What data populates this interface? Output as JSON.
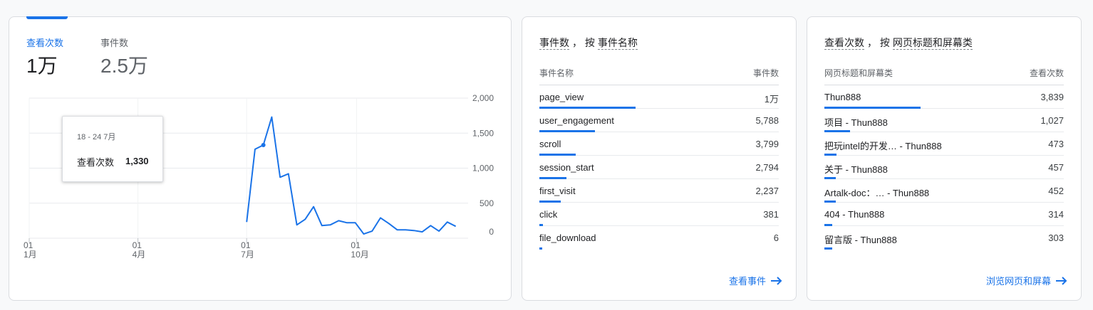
{
  "overview": {
    "tabs": [
      {
        "label": "查看次数",
        "value": "1万",
        "active": true
      },
      {
        "label": "事件数",
        "value": "2.5万",
        "active": false
      }
    ],
    "tooltip": {
      "date": "18 - 24 7月",
      "label": "查看次数",
      "value": "1,330"
    },
    "chart_data": {
      "type": "line",
      "x_tick_labels": [
        {
          "day": "01",
          "month": "1月"
        },
        {
          "day": "01",
          "month": "4月"
        },
        {
          "day": "01",
          "month": "7月"
        },
        {
          "day": "01",
          "month": "10月"
        }
      ],
      "y_tick_labels": [
        "2,000",
        "1,500",
        "1,000",
        "500",
        "0"
      ],
      "ylim": [
        0,
        2000
      ],
      "series": [
        {
          "color": "#1a73e8",
          "points": [
            [
              "2024-07-01",
              230
            ],
            [
              "2024-07-08",
              1270
            ],
            [
              "2024-07-15",
              1330
            ],
            [
              "2024-07-22",
              1730
            ],
            [
              "2024-07-29",
              870
            ],
            [
              "2024-08-05",
              920
            ],
            [
              "2024-08-12",
              190
            ],
            [
              "2024-08-19",
              270
            ],
            [
              "2024-08-26",
              450
            ],
            [
              "2024-09-02",
              180
            ],
            [
              "2024-09-09",
              190
            ],
            [
              "2024-09-16",
              250
            ],
            [
              "2024-09-23",
              220
            ],
            [
              "2024-09-30",
              220
            ],
            [
              "2024-10-07",
              60
            ],
            [
              "2024-10-14",
              100
            ],
            [
              "2024-10-21",
              290
            ],
            [
              "2024-10-28",
              210
            ],
            [
              "2024-11-04",
              120
            ],
            [
              "2024-11-11",
              120
            ],
            [
              "2024-11-18",
              110
            ],
            [
              "2024-11-25",
              90
            ],
            [
              "2024-12-02",
              180
            ],
            [
              "2024-12-09",
              100
            ],
            [
              "2024-12-16",
              230
            ],
            [
              "2024-12-23",
              170
            ]
          ],
          "highlight": "2024-07-15"
        }
      ],
      "grid": true
    }
  },
  "events": {
    "title_metric": "事件数",
    "title_sep": "， 按",
    "title_dim": "事件名称",
    "col_name": "事件名称",
    "col_value": "事件数",
    "rows": [
      {
        "name": "page_view",
        "value": "1万",
        "ratio": 1.0
      },
      {
        "name": "user_engagement",
        "value": "5,788",
        "ratio": 0.575
      },
      {
        "name": "scroll",
        "value": "3,799",
        "ratio": 0.378
      },
      {
        "name": "session_start",
        "value": "2,794",
        "ratio": 0.278
      },
      {
        "name": "first_visit",
        "value": "2,237",
        "ratio": 0.222
      },
      {
        "name": "click",
        "value": "381",
        "ratio": 0.038
      },
      {
        "name": "file_download",
        "value": "6",
        "ratio": 0.01
      }
    ],
    "link": "查看事件"
  },
  "pages": {
    "title_metric": "查看次数",
    "title_sep": "， 按",
    "title_dim": "网页标题和屏幕类",
    "col_name": "网页标题和屏幕类",
    "col_value": "查看次数",
    "rows": [
      {
        "name": "Thun888",
        "value": "3,839",
        "ratio": 1.0
      },
      {
        "name": "项目 - Thun888",
        "value": "1,027",
        "ratio": 0.267
      },
      {
        "name": "把玩intel的开发… - Thun888",
        "value": "473",
        "ratio": 0.123
      },
      {
        "name": "关于 - Thun888",
        "value": "457",
        "ratio": 0.119
      },
      {
        "name": "Artalk-doc：… - Thun888",
        "value": "452",
        "ratio": 0.118
      },
      {
        "name": "404 - Thun888",
        "value": "314",
        "ratio": 0.082
      },
      {
        "name": "留言版 - Thun888",
        "value": "303",
        "ratio": 0.079
      }
    ],
    "link": "浏览网页和屏幕"
  }
}
